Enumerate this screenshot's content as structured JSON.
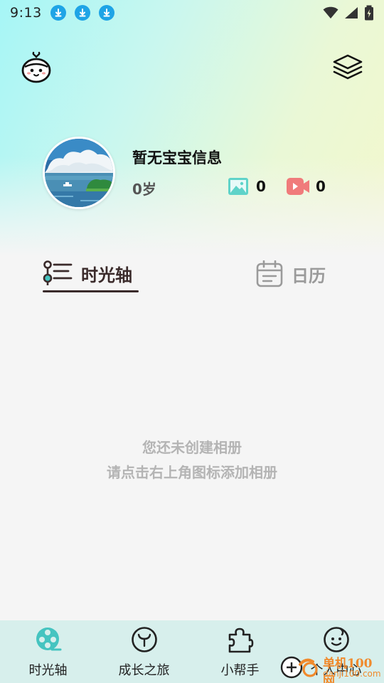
{
  "status_bar": {
    "time": "9:13",
    "notification_icons": [
      "download-icon",
      "download-icon",
      "download-icon"
    ],
    "right_icons": [
      "wifi-icon",
      "signal-icon",
      "battery-charging-icon"
    ]
  },
  "header": {
    "left_icon": "baby-face-icon",
    "right_icon": "layers-icon"
  },
  "profile": {
    "name": "暂无宝宝信息",
    "age": "0岁",
    "photo_count": "0",
    "video_count": "0"
  },
  "tabs": [
    {
      "label": "时光轴",
      "icon": "timeline-icon",
      "active": true
    },
    {
      "label": "日历",
      "icon": "calendar-icon",
      "active": false
    }
  ],
  "empty_state": {
    "line1": "您还未创建相册",
    "line2": "请点击右上角图标添加相册"
  },
  "bottom_nav": [
    {
      "label": "时光轴",
      "icon": "film-reel-icon",
      "active": true
    },
    {
      "label": "成长之旅",
      "icon": "sprout-icon",
      "active": false
    },
    {
      "label": "小帮手",
      "icon": "puzzle-icon",
      "active": false
    },
    {
      "label": "个人中心",
      "icon": "smiley-icon",
      "active": false
    }
  ],
  "watermark": {
    "line1": "单机100网",
    "line2": "danji100.com"
  },
  "colors": {
    "accent_teal": "#45c4c0",
    "photo_icon": "#5fd3c9",
    "video_icon": "#f07b7b",
    "nav_bg": "#d7efec"
  }
}
